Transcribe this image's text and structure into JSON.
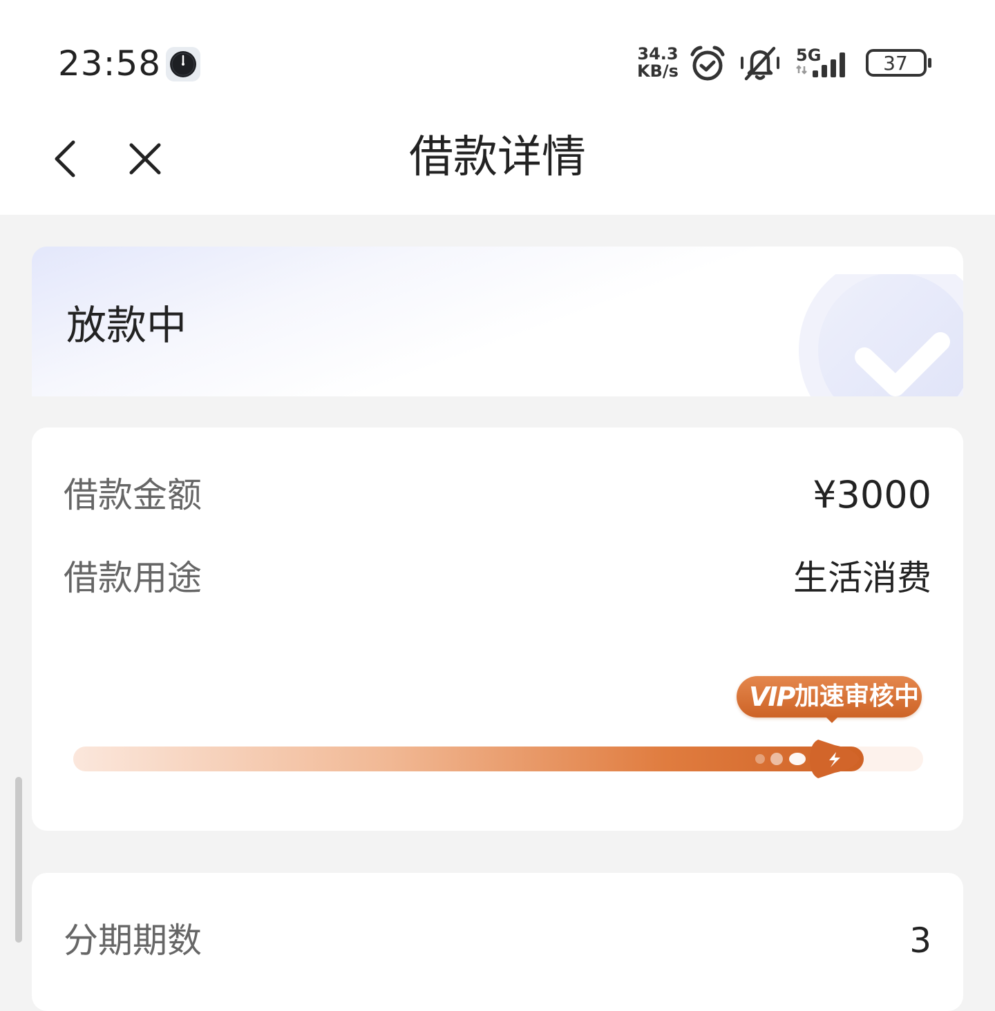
{
  "status_bar": {
    "time": "23:58",
    "net_speed_value": "34.3",
    "net_speed_unit": "KB/s",
    "network_type": "5G",
    "battery_level": "37",
    "icons": [
      "clock-app-icon",
      "alarm-icon",
      "mute-icon",
      "signal-icon",
      "battery-icon"
    ]
  },
  "nav": {
    "title": "借款详情",
    "back_icon": "chevron-left-icon",
    "close_icon": "close-icon"
  },
  "status_card": {
    "status": "放款中",
    "icon": "check-icon"
  },
  "loan_info": {
    "amount_label": "借款金额",
    "amount_value": "¥3000",
    "purpose_label": "借款用途",
    "purpose_value": "生活消费",
    "progress": {
      "badge_logo": "VIP",
      "badge_text": "加速审核中",
      "fraction": 0.93,
      "colors": {
        "start": "#fbe7dc",
        "end": "#cf6225"
      }
    }
  },
  "installments": {
    "label": "分期期数",
    "value": "3"
  },
  "colors": {
    "background": "#f3f3f3",
    "accent": "#cd6326",
    "card": "#ffffff"
  }
}
